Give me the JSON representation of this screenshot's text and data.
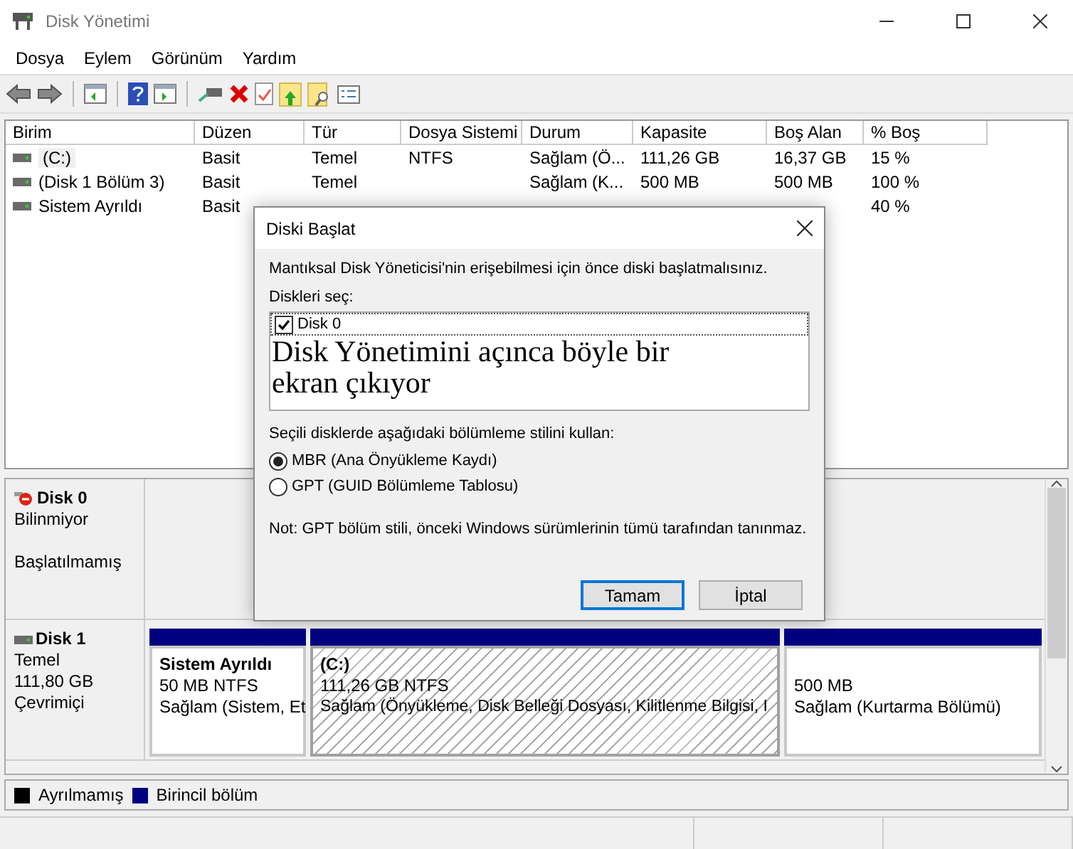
{
  "window": {
    "title": "Disk Yönetimi"
  },
  "menu": [
    "Dosya",
    "Eylem",
    "Görünüm",
    "Yardım"
  ],
  "table": {
    "columns": [
      "Birim",
      "Düzen",
      "Tür",
      "Dosya Sistemi",
      "Durum",
      "Kapasite",
      "Boş Alan",
      "% Boş"
    ],
    "rows": [
      {
        "cells": [
          "(C:)",
          "Basit",
          "Temel",
          "NTFS",
          "Sağlam (Ö...",
          "111,26 GB",
          "16,37 GB",
          "15 %"
        ],
        "selected": true
      },
      {
        "cells": [
          "(Disk 1 Bölüm 3)",
          "Basit",
          "Temel",
          null,
          "Sağlam (K...",
          "500 MB",
          "500 MB",
          "100 %"
        ],
        "selected": false
      },
      {
        "cells": [
          "Sistem Ayrıldı",
          "Basit",
          null,
          null,
          null,
          null,
          null,
          "40 %"
        ],
        "selected": false
      }
    ]
  },
  "disks": [
    {
      "kind": "uninitialized",
      "name": "Disk 0",
      "lines": [
        "Bilinmiyor",
        "Başlatılmamış"
      ]
    },
    {
      "kind": "basic",
      "name": "Disk 1",
      "lines": [
        "Temel",
        "111,80 GB",
        "Çevrimiçi"
      ],
      "partitions": [
        {
          "name": "Sistem Ayrıldı",
          "size": "50 MB NTFS",
          "status": "Sağlam (Sistem, Et",
          "selected": false
        },
        {
          "name": "(C:)",
          "size": "111,26 GB NTFS",
          "status": "Sağlam (Önyükleme, Disk Belleği Dosyası, Kilitlenme Bilgisi, I",
          "selected": true
        },
        {
          "size": "500 MB",
          "status": "Sağlam (Kurtarma Bölümü)",
          "selected": false
        }
      ]
    }
  ],
  "legend": [
    {
      "label": "Ayrılmamış",
      "color": "#000000"
    },
    {
      "label": "Birincil bölüm",
      "color": "#000080"
    }
  ],
  "dialog": {
    "title": "Diski Başlat",
    "message": "Mantıksal Disk Yöneticisi'nin erişebilmesi için önce diski başlatmalısınız.",
    "list_label": "Diskleri seç:",
    "disks": [
      {
        "label": "Disk 0",
        "checked": true
      }
    ],
    "annotation": "Disk Yönetimini açınca böyle bir ekran çıkıyor",
    "style_label": "Seçili disklerde aşağıdaki bölümleme stilini kullan:",
    "options": [
      {
        "label": "MBR (Ana Önyükleme Kaydı)",
        "selected": true
      },
      {
        "label": "GPT (GUID Bölümleme Tablosu)",
        "selected": false
      }
    ],
    "note": "Not: GPT bölüm stili, önceki Windows sürümlerinin tümü tarafından tanınmaz.",
    "buttons": [
      {
        "label": "Tamam",
        "default": true
      },
      {
        "label": "İptal",
        "default": false
      }
    ]
  }
}
